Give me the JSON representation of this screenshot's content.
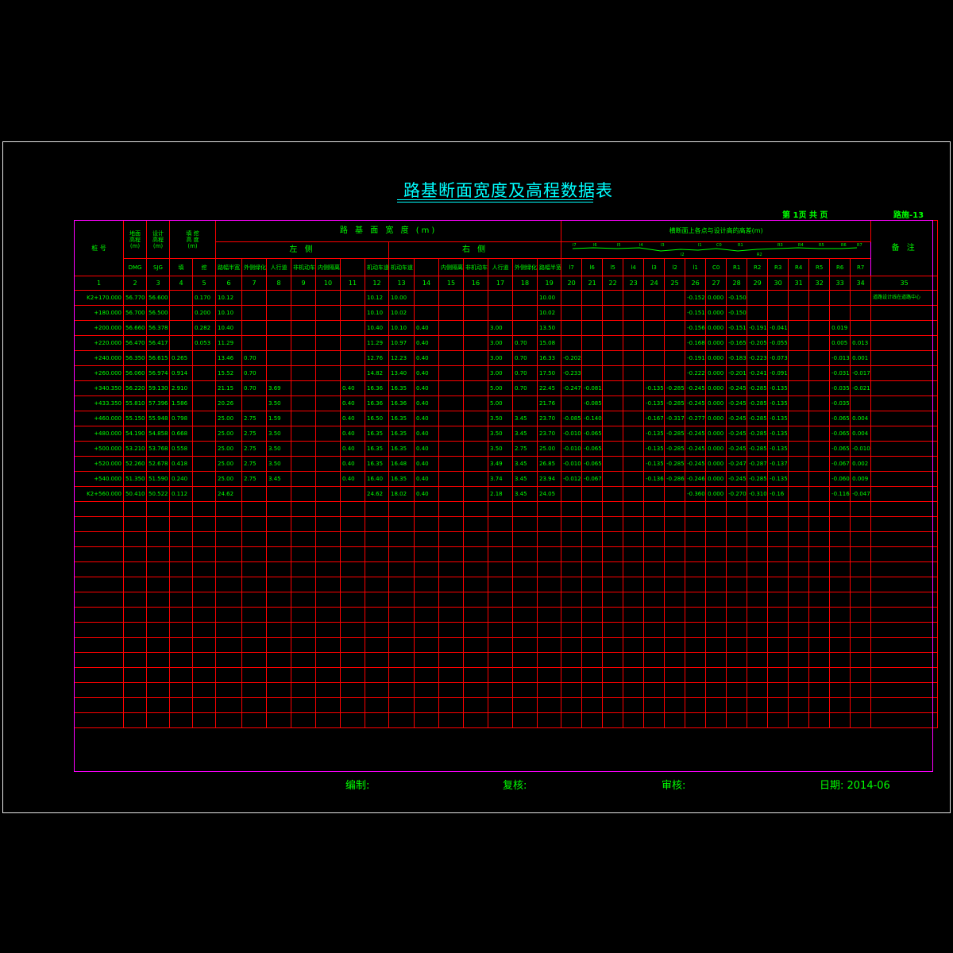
{
  "title": "路基断面宽度及高程数据表",
  "page_info": {
    "page": "第 1页 共  页",
    "drawing_no": "路施-13"
  },
  "header": {
    "station": "桩  号",
    "ground_elev": "地面\n高程\n(m)",
    "design_elev": "设计\n高程\n(m)",
    "fill_cut": "填 挖\n高 度\n(m)",
    "ground_elev_unit": "(m)",
    "design_elev_unit": "(m)",
    "fill_cut_unit": "(m)",
    "ground_elev_sub": "DMG",
    "design_elev_sub": "SJG",
    "fill": "填",
    "cut": "挖",
    "roadbed_width": "路 基 面 宽 度  (m)",
    "left": "左   侧",
    "right": "右   侧",
    "left_cols": [
      "路幅半宽",
      "外侧绿化带宽",
      "人行道",
      "非机动车道",
      "内侧隔离带",
      "",
      "机动车道"
    ],
    "right_cols": [
      "机动车道",
      "",
      "内侧隔离带宽",
      "非机动车道",
      "人行道",
      "外侧绿化带宽",
      "路幅半宽"
    ],
    "elev_diff": "横断面上各点与设计高的高差(m)",
    "point_labels": [
      "l7",
      "l6",
      "l5",
      "l4",
      "l3",
      "l2",
      "l1",
      "C0",
      "R1",
      "R2",
      "R3",
      "R4",
      "R5",
      "R6",
      "R7"
    ],
    "remarks": "备 注"
  },
  "col_numbers": [
    "1",
    "2",
    "3",
    "4",
    "5",
    "6",
    "7",
    "8",
    "9",
    "10",
    "11",
    "12",
    "13",
    "14",
    "15",
    "16",
    "17",
    "18",
    "19",
    "20",
    "21",
    "22",
    "23",
    "24",
    "25",
    "26",
    "27",
    "28",
    "29",
    "30",
    "31",
    "32",
    "33",
    "34",
    "35"
  ],
  "rows": [
    [
      "K2+170.000",
      "56.770",
      "56.600",
      "",
      "0.170",
      "10.12",
      "",
      "",
      "",
      "",
      "",
      "10.12",
      "10.00",
      "",
      "",
      "",
      "",
      "",
      "10.00",
      "",
      "",
      "",
      "",
      "",
      "",
      "-0.152",
      "0.000",
      "-0.150",
      "",
      "",
      "",
      "",
      "",
      "",
      "道路设计线在道路中心"
    ],
    [
      "+180.000",
      "56.700",
      "56.500",
      "",
      "0.200",
      "10.10",
      "",
      "",
      "",
      "",
      "",
      "10.10",
      "10.02",
      "",
      "",
      "",
      "",
      "",
      "10.02",
      "",
      "",
      "",
      "",
      "",
      "",
      "-0.151",
      "0.000",
      "-0.150",
      "",
      "",
      "",
      "",
      "",
      "",
      ""
    ],
    [
      "+200.000",
      "56.660",
      "56.378",
      "",
      "0.282",
      "10.40",
      "",
      "",
      "",
      "",
      "",
      "10.40",
      "10.10",
      "0.40",
      "",
      "",
      "3.00",
      "",
      "13.50",
      "",
      "",
      "",
      "",
      "",
      "",
      "-0.156",
      "0.000",
      "-0.151",
      "-0.191",
      "-0.041",
      "",
      "",
      "0.019",
      "",
      ""
    ],
    [
      "+220.000",
      "56.470",
      "56.417",
      "",
      "0.053",
      "11.29",
      "",
      "",
      "",
      "",
      "",
      "11.29",
      "10.97",
      "0.40",
      "",
      "",
      "3.00",
      "0.70",
      "15.08",
      "",
      "",
      "",
      "",
      "",
      "",
      "-0.168",
      "0.000",
      "-0.165",
      "-0.205",
      "-0.055",
      "",
      "",
      "0.005",
      "0.013",
      ""
    ],
    [
      "+240.000",
      "56.350",
      "56.615",
      "0.265",
      "",
      "13.46",
      "0.70",
      "",
      "",
      "",
      "",
      "12.76",
      "12.23",
      "0.40",
      "",
      "",
      "3.00",
      "0.70",
      "16.33",
      "-0.202",
      "",
      "",
      "",
      "",
      "",
      "-0.191",
      "0.000",
      "-0.183",
      "-0.223",
      "-0.073",
      "",
      "",
      "-0.013",
      "0.001",
      ""
    ],
    [
      "+260.000",
      "56.060",
      "56.974",
      "0.914",
      "",
      "15.52",
      "0.70",
      "",
      "",
      "",
      "",
      "14.82",
      "13.40",
      "0.40",
      "",
      "",
      "3.00",
      "0.70",
      "17.50",
      "-0.233",
      "",
      "",
      "",
      "",
      "",
      "-0.222",
      "0.000",
      "-0.201",
      "-0.241",
      "-0.091",
      "",
      "",
      "-0.031",
      "-0.017",
      ""
    ],
    [
      "+340.350",
      "56.220",
      "59.130",
      "2.910",
      "",
      "21.15",
      "0.70",
      "3.69",
      "",
      "",
      "0.40",
      "16.36",
      "16.35",
      "0.40",
      "",
      "",
      "5.00",
      "0.70",
      "22.45",
      "-0.247",
      "-0.081",
      "",
      "",
      "-0.135",
      "-0.285",
      "-0.245",
      "0.000",
      "-0.245",
      "-0.285",
      "-0.135",
      "",
      "",
      "-0.035",
      "-0.021",
      ""
    ],
    [
      "+433.350",
      "55.810",
      "57.396",
      "1.586",
      "",
      "20.26",
      "",
      "3.50",
      "",
      "",
      "0.40",
      "16.36",
      "16.36",
      "0.40",
      "",
      "",
      "5.00",
      "",
      "21.76",
      "",
      "-0.085",
      "",
      "",
      "-0.135",
      "-0.285",
      "-0.245",
      "0.000",
      "-0.245",
      "-0.285",
      "-0.135",
      "",
      "",
      "-0.035",
      "",
      ""
    ],
    [
      "+460.000",
      "55.150",
      "55.948",
      "0.798",
      "",
      "25.00",
      "2.75",
      "1.59",
      "",
      "",
      "0.40",
      "16.50",
      "16.35",
      "0.40",
      "",
      "",
      "3.50",
      "3.45",
      "23.70",
      "-0.085",
      "-0.140",
      "",
      "",
      "-0.167",
      "-0.317",
      "-0.277",
      "0.000",
      "-0.245",
      "-0.285",
      "-0.135",
      "",
      "",
      "-0.065",
      "0.004",
      ""
    ],
    [
      "+480.000",
      "54.190",
      "54.858",
      "0.668",
      "",
      "25.00",
      "2.75",
      "3.50",
      "",
      "",
      "0.40",
      "16.35",
      "16.35",
      "0.40",
      "",
      "",
      "3.50",
      "3.45",
      "23.70",
      "-0.010",
      "-0.065",
      "",
      "",
      "-0.135",
      "-0.285",
      "-0.245",
      "0.000",
      "-0.245",
      "-0.285",
      "-0.135",
      "",
      "",
      "-0.065",
      "0.004",
      ""
    ],
    [
      "+500.000",
      "53.210",
      "53.768",
      "0.558",
      "",
      "25.00",
      "2.75",
      "3.50",
      "",
      "",
      "0.40",
      "16.35",
      "16.35",
      "0.40",
      "",
      "",
      "3.50",
      "2.75",
      "25.00",
      "-0.010",
      "-0.065",
      "",
      "",
      "-0.135",
      "-0.285",
      "-0.245",
      "0.000",
      "-0.245",
      "-0.285",
      "-0.135",
      "",
      "",
      "-0.065",
      "-0.010",
      ""
    ],
    [
      "+520.000",
      "52.260",
      "52.678",
      "0.418",
      "",
      "25.00",
      "2.75",
      "3.50",
      "",
      "",
      "0.40",
      "16.35",
      "16.48",
      "0.40",
      "",
      "",
      "3.49",
      "3.45",
      "26.85",
      "-0.010",
      "-0.065",
      "",
      "",
      "-0.135",
      "-0.285",
      "-0.245",
      "0.000",
      "-0.247",
      "-0.287",
      "-0.137",
      "",
      "",
      "-0.067",
      "0.002",
      ""
    ],
    [
      "+540.000",
      "51.350",
      "51.590",
      "0.240",
      "",
      "25.00",
      "2.75",
      "3.45",
      "",
      "",
      "0.40",
      "16.40",
      "16.35",
      "0.40",
      "",
      "",
      "3.74",
      "3.45",
      "23.94",
      "-0.012",
      "-0.067",
      "",
      "",
      "-0.136",
      "-0.286",
      "-0.246",
      "0.000",
      "-0.245",
      "-0.285",
      "-0.135",
      "",
      "",
      "-0.060",
      "0.009",
      ""
    ],
    [
      "K2+560.000",
      "50.410",
      "50.522",
      "0.112",
      "",
      "24.62",
      "",
      "",
      "",
      "",
      "",
      "24.62",
      "18.02",
      "0.40",
      "",
      "",
      "2.18",
      "3.45",
      "24.05",
      "",
      "",
      "",
      "",
      "",
      "",
      "-0.360",
      "0.000",
      "-0.270",
      "-0.310",
      "-0.16",
      "",
      "",
      "-0.116",
      "-0.047",
      ""
    ]
  ],
  "empty_rows": 15,
  "footer": {
    "compiled": "编制:",
    "checked": "复核:",
    "reviewed": "审核:",
    "date": "日期: 2014-06"
  }
}
